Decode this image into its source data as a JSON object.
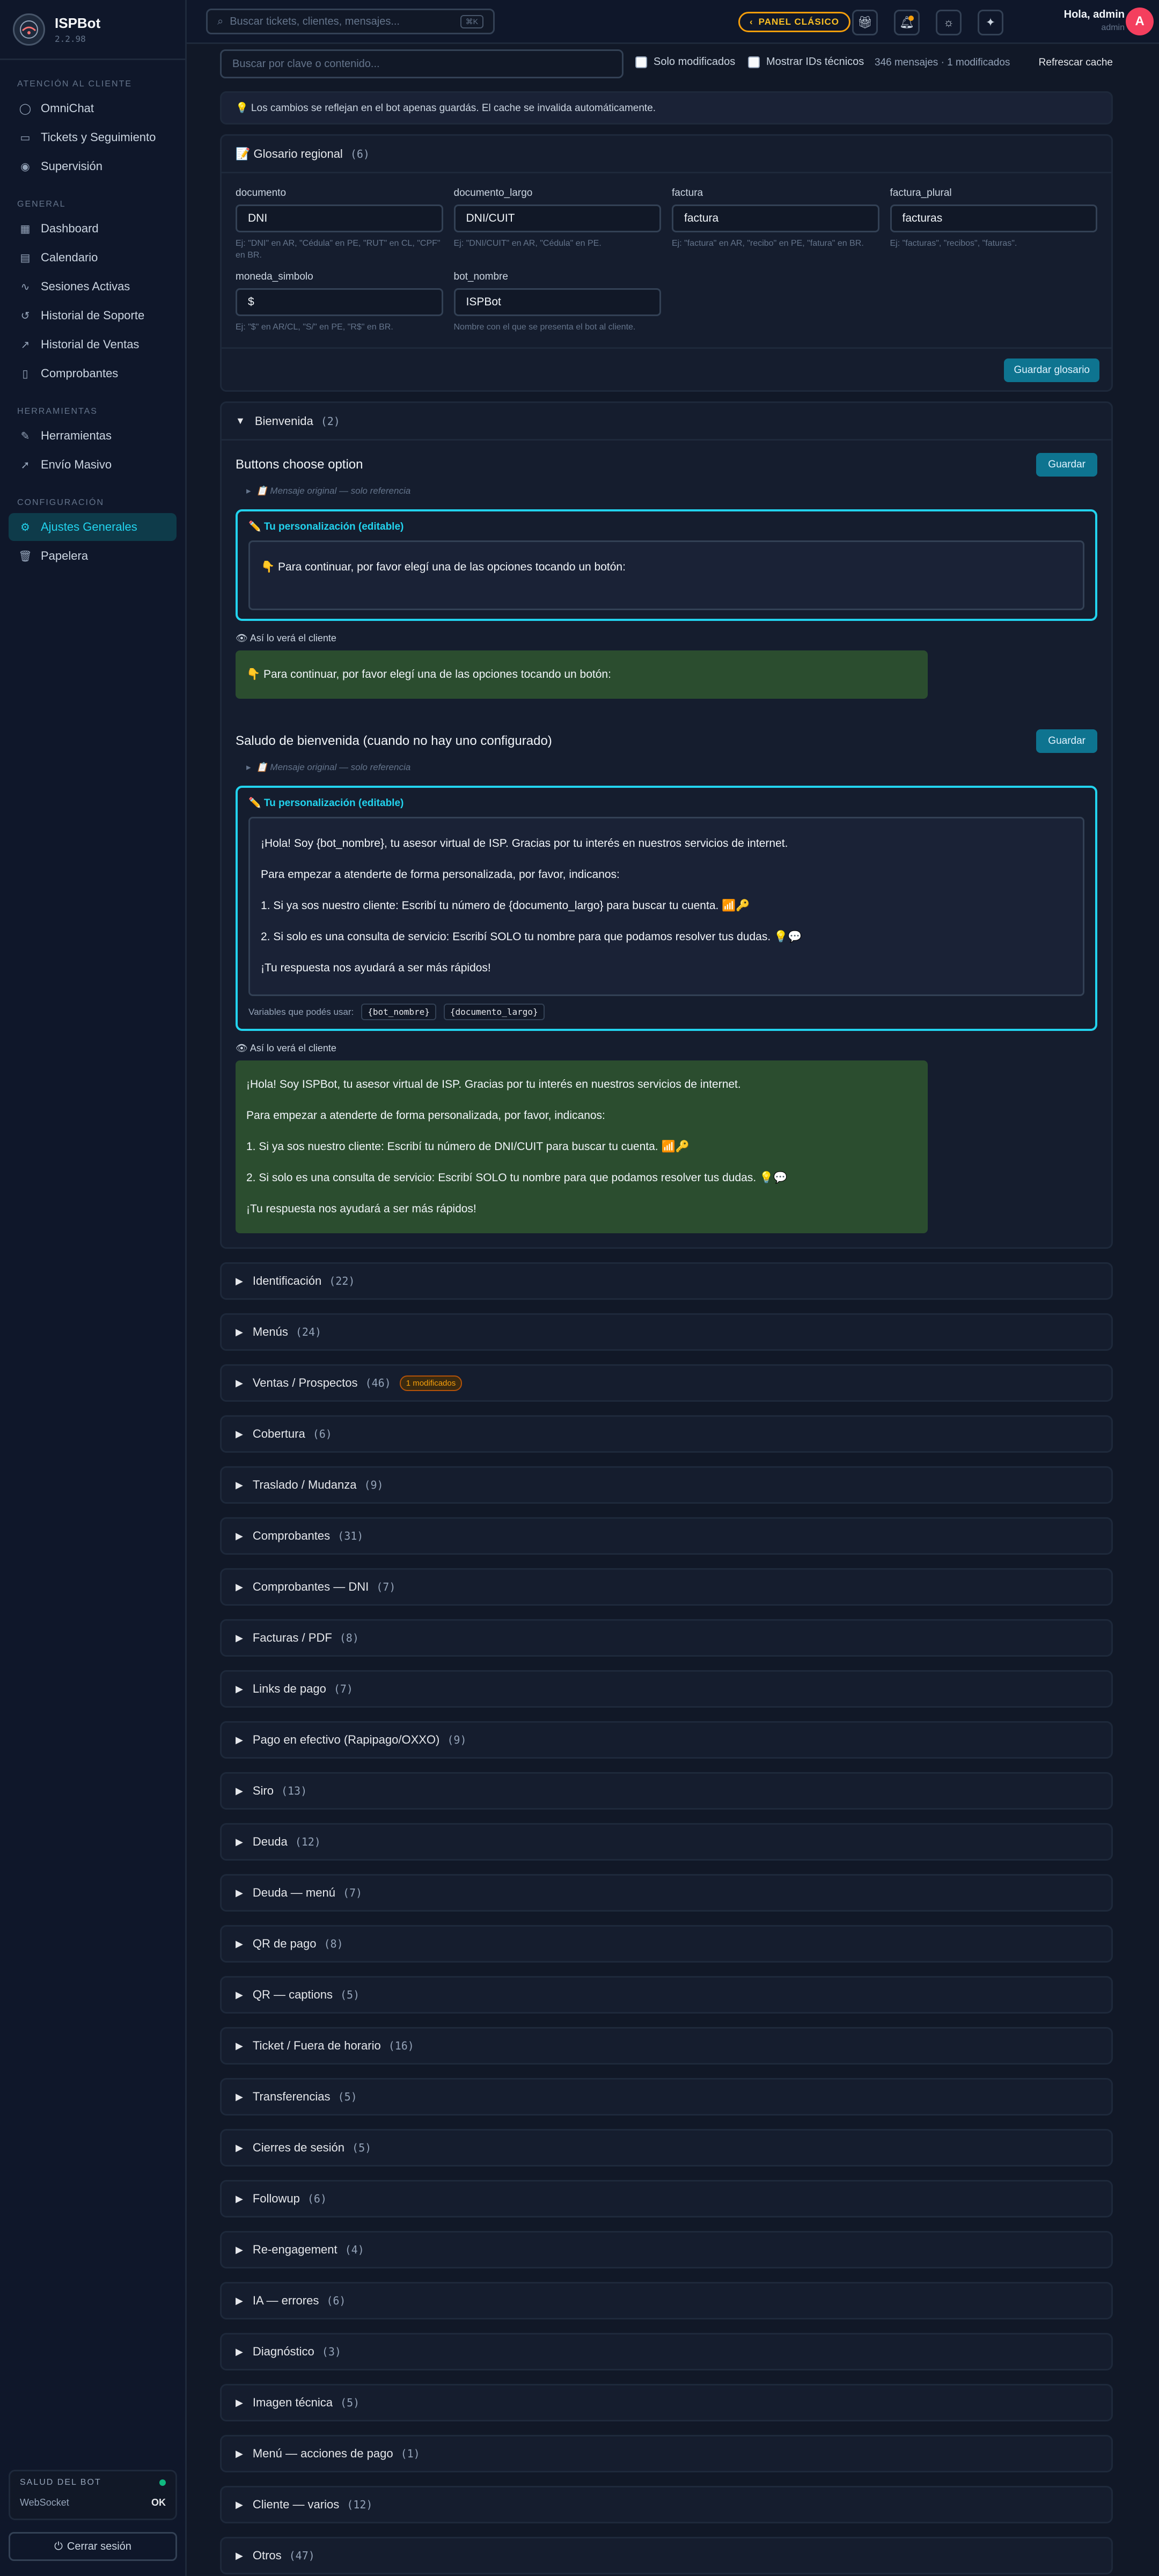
{
  "brand": {
    "name": "ISPBot",
    "version": "2.2.98"
  },
  "sidebar": {
    "sections": [
      {
        "title": "Atención al cliente",
        "items": [
          {
            "label": "OmniChat",
            "icon": "chat-icon"
          },
          {
            "label": "Tickets y Seguimiento",
            "icon": "ticket-icon"
          },
          {
            "label": "Supervisión",
            "icon": "eye-icon"
          }
        ]
      },
      {
        "title": "General",
        "items": [
          {
            "label": "Dashboard",
            "icon": "grid-icon"
          },
          {
            "label": "Calendario",
            "icon": "calendar-icon"
          },
          {
            "label": "Sesiones Activas",
            "icon": "activity-icon"
          },
          {
            "label": "Historial de Soporte",
            "icon": "history-icon"
          },
          {
            "label": "Historial de Ventas",
            "icon": "trend-icon"
          },
          {
            "label": "Comprobantes",
            "icon": "receipt-icon"
          }
        ]
      },
      {
        "title": "Herramientas",
        "items": [
          {
            "label": "Herramientas",
            "icon": "wrench-icon"
          },
          {
            "label": "Envío Masivo",
            "icon": "send-icon"
          }
        ]
      },
      {
        "title": "Configuración",
        "items": [
          {
            "label": "Ajustes Generales",
            "icon": "gear-icon"
          },
          {
            "label": "Papelera",
            "icon": "trash-icon"
          }
        ]
      }
    ],
    "health": {
      "title": "SALUD DEL BOT",
      "label": "WebSocket",
      "value": "OK",
      "status_color": "#10b981"
    },
    "logout": "Cerrar sesión"
  },
  "header": {
    "search_placeholder": "Buscar tickets, clientes, mensajes...",
    "search_kbd": "⌘K",
    "classic_panel": "PANEL CLÁSICO",
    "user_greeting": "Hola, admin",
    "user_role": "admin",
    "avatar_letter": "A"
  },
  "toolbar": {
    "filter_placeholder": "Buscar por clave o contenido...",
    "only_modified": "Solo modificados",
    "show_ids": "Mostrar IDs técnicos",
    "stats": "346 mensajes · 1 modificados",
    "refresh": "Refrescar cache"
  },
  "notice": "💡 Los cambios se reflejan en el bot apenas guardás. El cache se invalida automáticamente.",
  "glossary": {
    "title": "📝 Glosario regional",
    "count": "(6)",
    "fields": [
      {
        "label": "documento",
        "value": "DNI",
        "hint": "Ej: \"DNI\" en AR, \"Cédula\" en PE, \"RUT\" en CL, \"CPF\" en BR."
      },
      {
        "label": "documento_largo",
        "value": "DNI/CUIT",
        "hint": "Ej: \"DNI/CUIT\" en AR, \"Cédula\" en PE."
      },
      {
        "label": "factura",
        "value": "factura",
        "hint": "Ej: \"factura\" en AR, \"recibo\" en PE, \"fatura\" en BR."
      },
      {
        "label": "factura_plural",
        "value": "facturas",
        "hint": "Ej: \"facturas\", \"recibos\", \"faturas\"."
      },
      {
        "label": "moneda_simbolo",
        "value": "$",
        "hint": "Ej: \"$\" en AR/CL, \"S/\" en PE, \"R$\" en BR."
      },
      {
        "label": "bot_nombre",
        "value": "ISPBot",
        "hint": "Nombre con el que se presenta el bot al cliente."
      }
    ],
    "save": "Guardar glosario"
  },
  "welcome": {
    "title": "Bienvenida",
    "count": "(2)",
    "save": "Guardar",
    "original_label": "📋 Mensaje original — solo referencia",
    "edit_label": "✏️ Tu personalización (editable)",
    "preview_label": "👁 Así lo verá el cliente",
    "vars_label": "Variables que podés usar:",
    "msg1": {
      "title": "Buttons choose option",
      "edit_text": "👇 Para continuar, por favor elegí una de las opciones tocando un botón:",
      "preview": "👇 Para continuar, por favor elegí una de las opciones tocando un botón:"
    },
    "msg2": {
      "title": "Saludo de bienvenida (cuando no hay uno configurado)",
      "edit_lines": [
        "¡Hola! Soy {bot_nombre}, tu asesor virtual de ISP. Gracias por tu interés en nuestros servicios de internet.",
        "Para empezar a atenderte de forma personalizada, por favor, indicanos:",
        "1. Si ya sos nuestro cliente: Escribí tu número de {documento_largo} para buscar tu cuenta. 📶🔑",
        "2. Si solo es una consulta de servicio: Escribí SOLO tu nombre para que podamos resolver tus dudas. 💡💬",
        "¡Tu respuesta nos ayudará a ser más rápidos!"
      ],
      "vars": [
        "{bot_nombre}",
        "{documento_largo}"
      ],
      "preview_lines": [
        "¡Hola! Soy ISPBot, tu asesor virtual de ISP. Gracias por tu interés en nuestros servicios de internet.",
        "Para empezar a atenderte de forma personalizada, por favor, indicanos:",
        "1. Si ya sos nuestro cliente: Escribí tu número de DNI/CUIT para buscar tu cuenta. 📶🔑",
        "2. Si solo es una consulta de servicio: Escribí SOLO tu nombre para que podamos resolver tus dudas. 💡💬",
        "¡Tu respuesta nos ayudará a ser más rápidos!"
      ]
    }
  },
  "categories": [
    {
      "label": "Identificación",
      "count": "(22)"
    },
    {
      "label": "Menús",
      "count": "(24)"
    },
    {
      "label": "Ventas / Prospectos",
      "count": "(46)",
      "badge": "1 modificados"
    },
    {
      "label": "Cobertura",
      "count": "(6)"
    },
    {
      "label": "Traslado / Mudanza",
      "count": "(9)"
    },
    {
      "label": "Comprobantes",
      "count": "(31)"
    },
    {
      "label": "Comprobantes — DNI",
      "count": "(7)"
    },
    {
      "label": "Facturas / PDF",
      "count": "(8)"
    },
    {
      "label": "Links de pago",
      "count": "(7)"
    },
    {
      "label": "Pago en efectivo (Rapipago/OXXO)",
      "count": "(9)"
    },
    {
      "label": "Siro",
      "count": "(13)"
    },
    {
      "label": "Deuda",
      "count": "(12)"
    },
    {
      "label": "Deuda — menú",
      "count": "(7)"
    },
    {
      "label": "QR de pago",
      "count": "(8)"
    },
    {
      "label": "QR — captions",
      "count": "(5)"
    },
    {
      "label": "Ticket / Fuera de horario",
      "count": "(16)"
    },
    {
      "label": "Transferencias",
      "count": "(5)"
    },
    {
      "label": "Cierres de sesión",
      "count": "(5)"
    },
    {
      "label": "Followup",
      "count": "(6)"
    },
    {
      "label": "Re-engagement",
      "count": "(4)"
    },
    {
      "label": "IA — errores",
      "count": "(6)"
    },
    {
      "label": "Diagnóstico",
      "count": "(3)"
    },
    {
      "label": "Imagen técnica",
      "count": "(5)"
    },
    {
      "label": "Menú — acciones de pago",
      "count": "(1)"
    },
    {
      "label": "Cliente — varios",
      "count": "(12)"
    },
    {
      "label": "Otros",
      "count": "(47)"
    }
  ]
}
